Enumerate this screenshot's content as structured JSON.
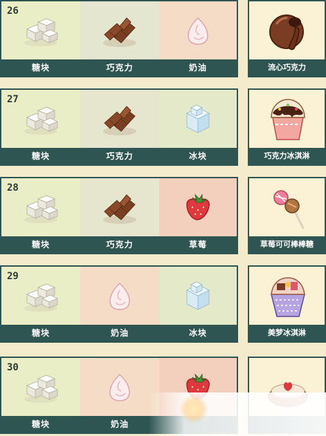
{
  "colors": {
    "page_bg": "#f4ebcd",
    "border_dark_teal": "#2e5552",
    "cell_pale_yellow": "#f0ecc8",
    "cell_pale_green": "#e4e9c8",
    "cell_pale_gray_green": "#e6e4cc",
    "cell_pale_pink": "#f5dfc9",
    "cell_salmon": "#f3d2c0",
    "result_bg": "#fbf1d4",
    "label_text": "#ffffff"
  },
  "recipes": [
    {
      "number": "26",
      "ingredients": [
        {
          "label": "糖块",
          "icon": "sugar-cube-icon",
          "bg": "#eaeec7"
        },
        {
          "label": "巧克力",
          "icon": "chocolate-icon",
          "bg": "#e4e6cf"
        },
        {
          "label": "奶油",
          "icon": "cream-icon",
          "bg": "#f5dcc6"
        }
      ],
      "result": {
        "label": "流心巧克力",
        "icon": "lava-chocolate-icon"
      }
    },
    {
      "number": "27",
      "ingredients": [
        {
          "label": "糖块",
          "icon": "sugar-cube-icon",
          "bg": "#eaeec7"
        },
        {
          "label": "巧克力",
          "icon": "chocolate-icon",
          "bg": "#e6e6cf"
        },
        {
          "label": "冰块",
          "icon": "ice-cube-icon",
          "bg": "#e4eac9"
        }
      ],
      "result": {
        "label": "巧克力冰淇淋",
        "icon": "chocolate-sundae-icon"
      }
    },
    {
      "number": "28",
      "ingredients": [
        {
          "label": "糖块",
          "icon": "sugar-cube-icon",
          "bg": "#eaeec7"
        },
        {
          "label": "巧克力",
          "icon": "chocolate-icon",
          "bg": "#e6e6cf"
        },
        {
          "label": "草莓",
          "icon": "strawberry-icon",
          "bg": "#f3cfbd"
        }
      ],
      "result": {
        "label": "草莓可可棒棒糖",
        "icon": "lollipop-icon"
      }
    },
    {
      "number": "29",
      "ingredients": [
        {
          "label": "糖块",
          "icon": "sugar-cube-icon",
          "bg": "#eaeec7"
        },
        {
          "label": "奶油",
          "icon": "cream-icon",
          "bg": "#f5dcc6"
        },
        {
          "label": "冰块",
          "icon": "ice-cube-icon",
          "bg": "#e4eac9"
        }
      ],
      "result": {
        "label": "美梦冰淇淋",
        "icon": "dream-sundae-icon"
      }
    },
    {
      "number": "30",
      "ingredients": [
        {
          "label": "糖块",
          "icon": "sugar-cube-icon",
          "bg": "#eaeec7"
        },
        {
          "label": "奶油",
          "icon": "cream-icon",
          "bg": "#f5dcc6"
        },
        {
          "label": "",
          "icon": "strawberry-icon",
          "bg": "#f3cfbd"
        }
      ],
      "result": {
        "label": "",
        "icon": "strawberry-cake-icon"
      }
    }
  ]
}
